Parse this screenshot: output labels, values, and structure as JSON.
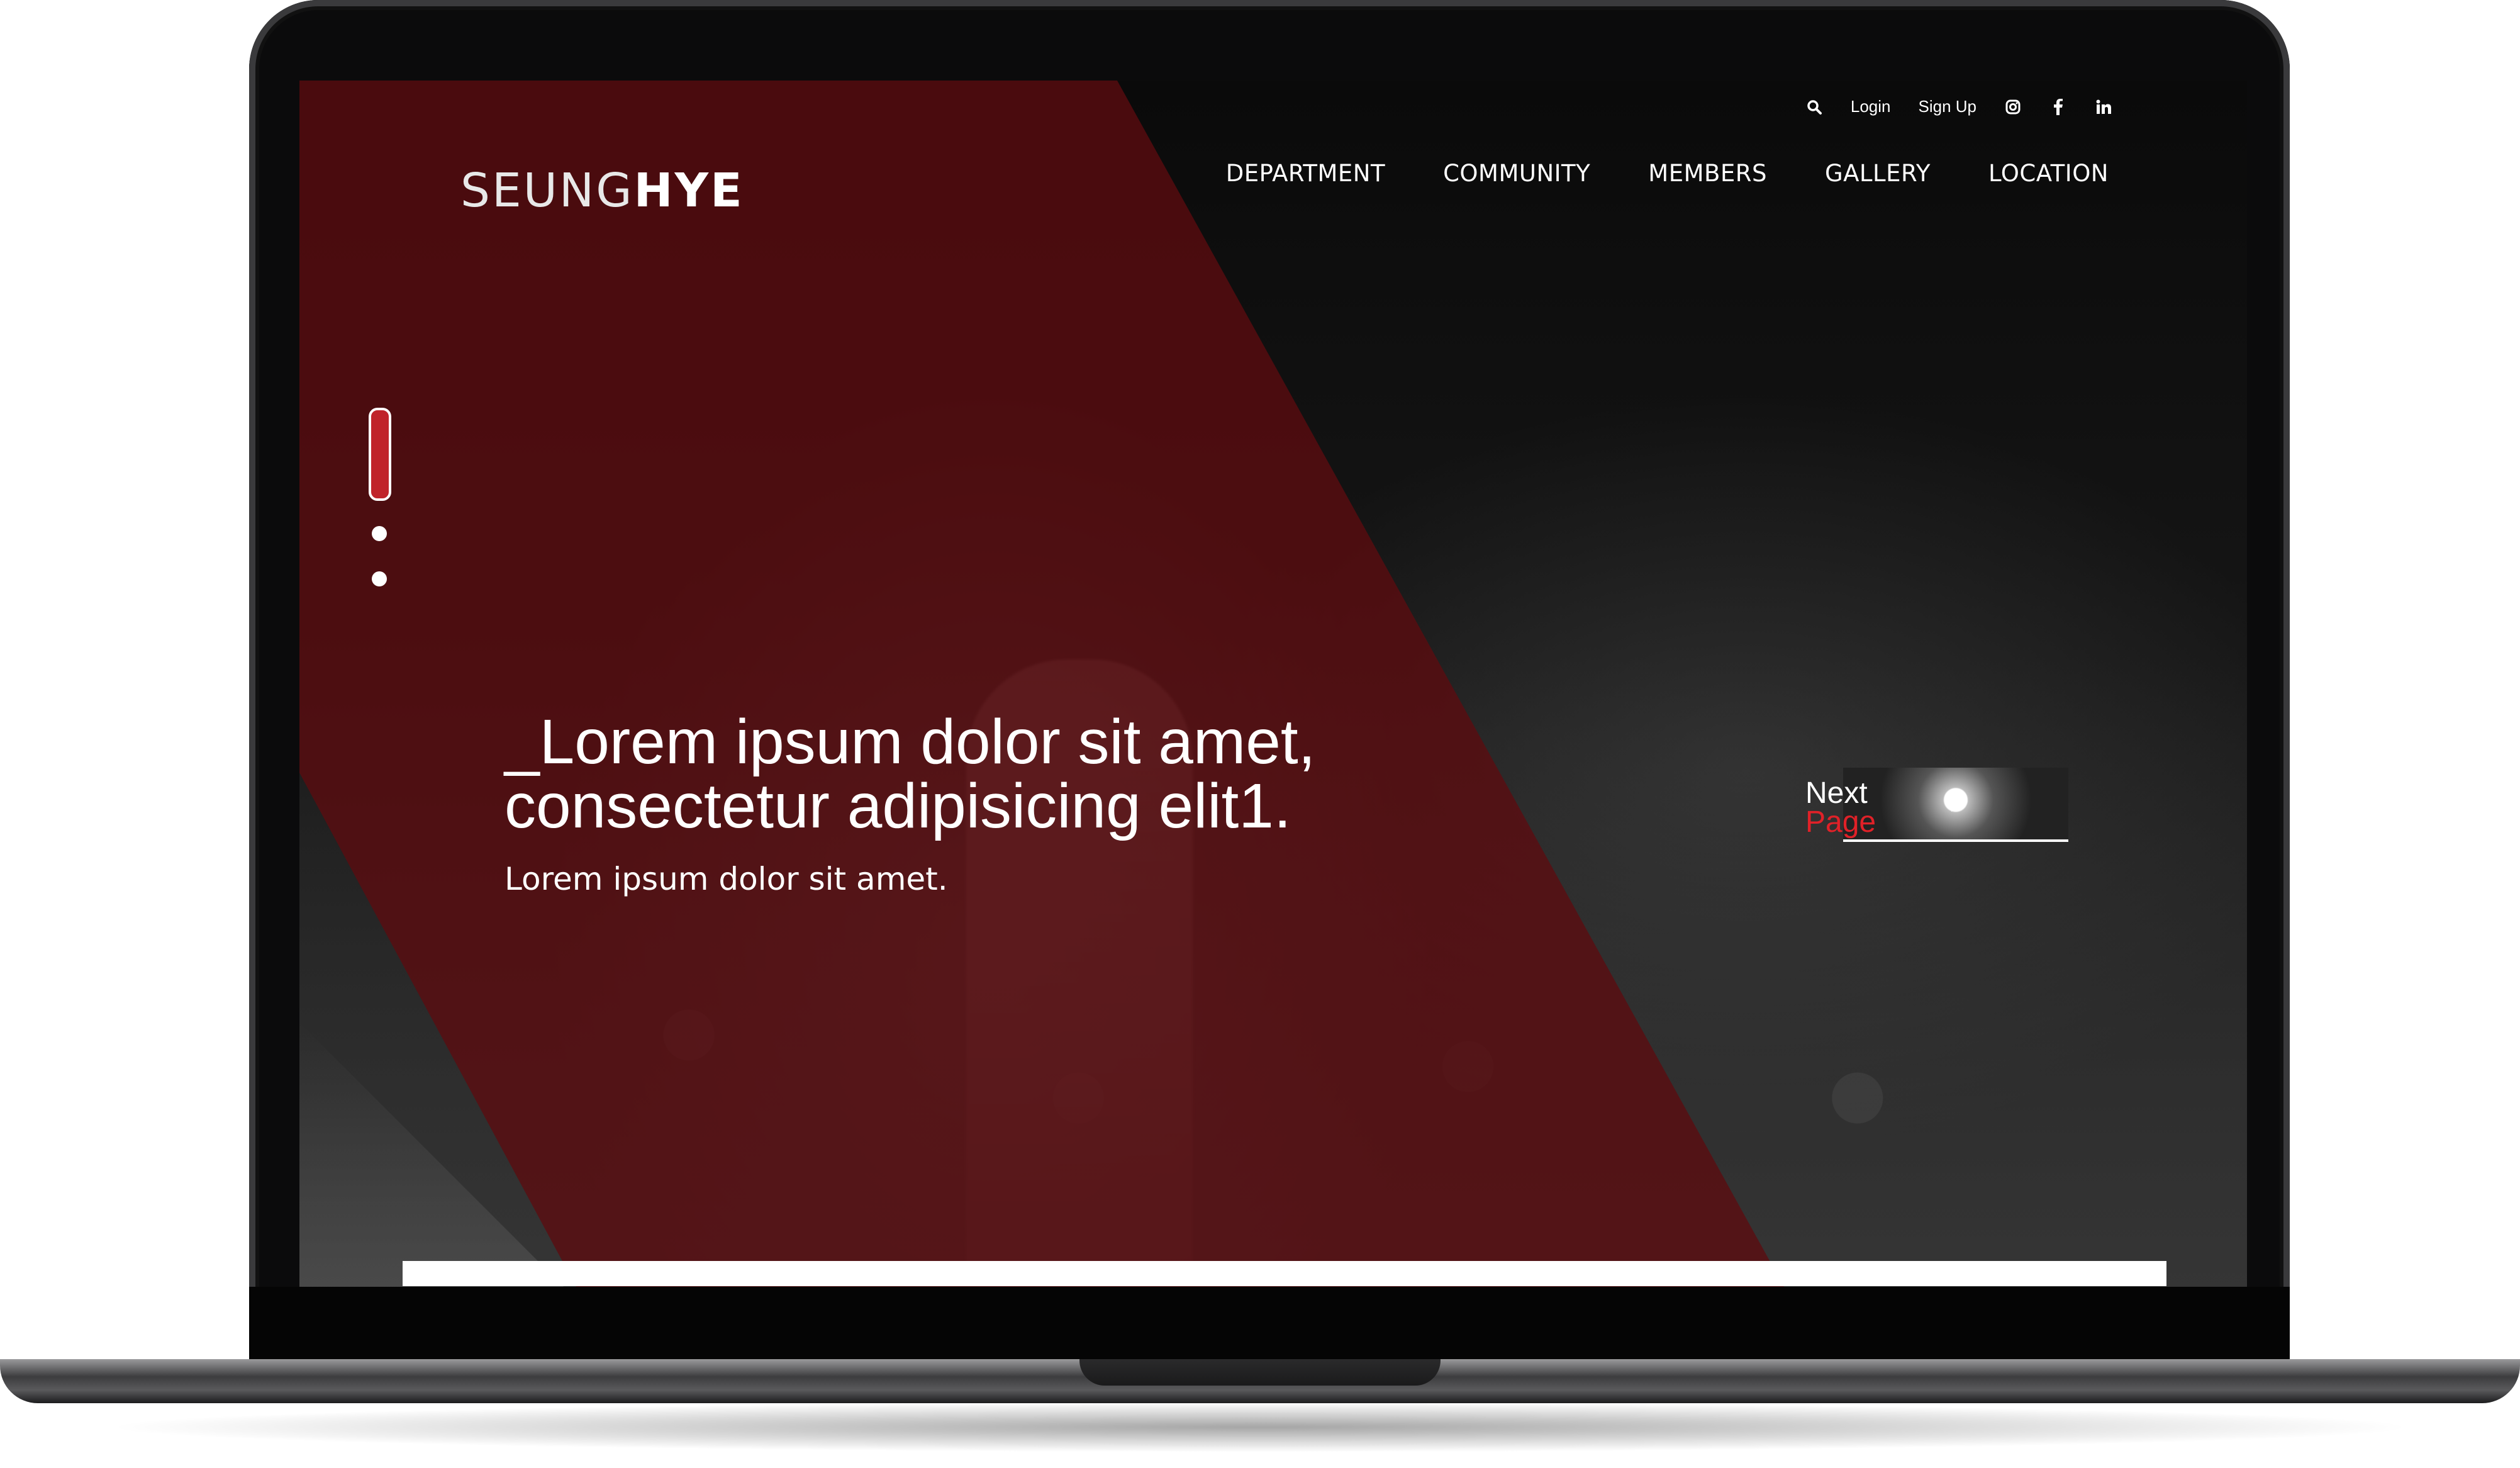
{
  "brand": {
    "logo_light": "SEUNG",
    "logo_bold": "HYE"
  },
  "utility": {
    "search_icon": "search-icon",
    "login": "Login",
    "signup": "Sign Up",
    "social": [
      "instagram-icon",
      "facebook-icon",
      "linkedin-icon"
    ]
  },
  "nav": {
    "items": [
      {
        "label": "DEPARTMENT"
      },
      {
        "label": "COMMUNITY"
      },
      {
        "label": "MEMBERS"
      },
      {
        "label": "GALLERY"
      },
      {
        "label": "LOCATION"
      }
    ]
  },
  "hero": {
    "headline_line1": "_Lorem ipsum dolor sit amet,",
    "headline_line2": "consectetur adipisicing elit1.",
    "subline": "Lorem ipsum dolor sit amet."
  },
  "slider": {
    "active_index": 0,
    "count": 3
  },
  "next_page": {
    "label_line1": "Next",
    "label_line2": "Page"
  },
  "colors": {
    "accent": "#c0232a",
    "band": "#5c0c10",
    "background": "#0d0d0e"
  }
}
